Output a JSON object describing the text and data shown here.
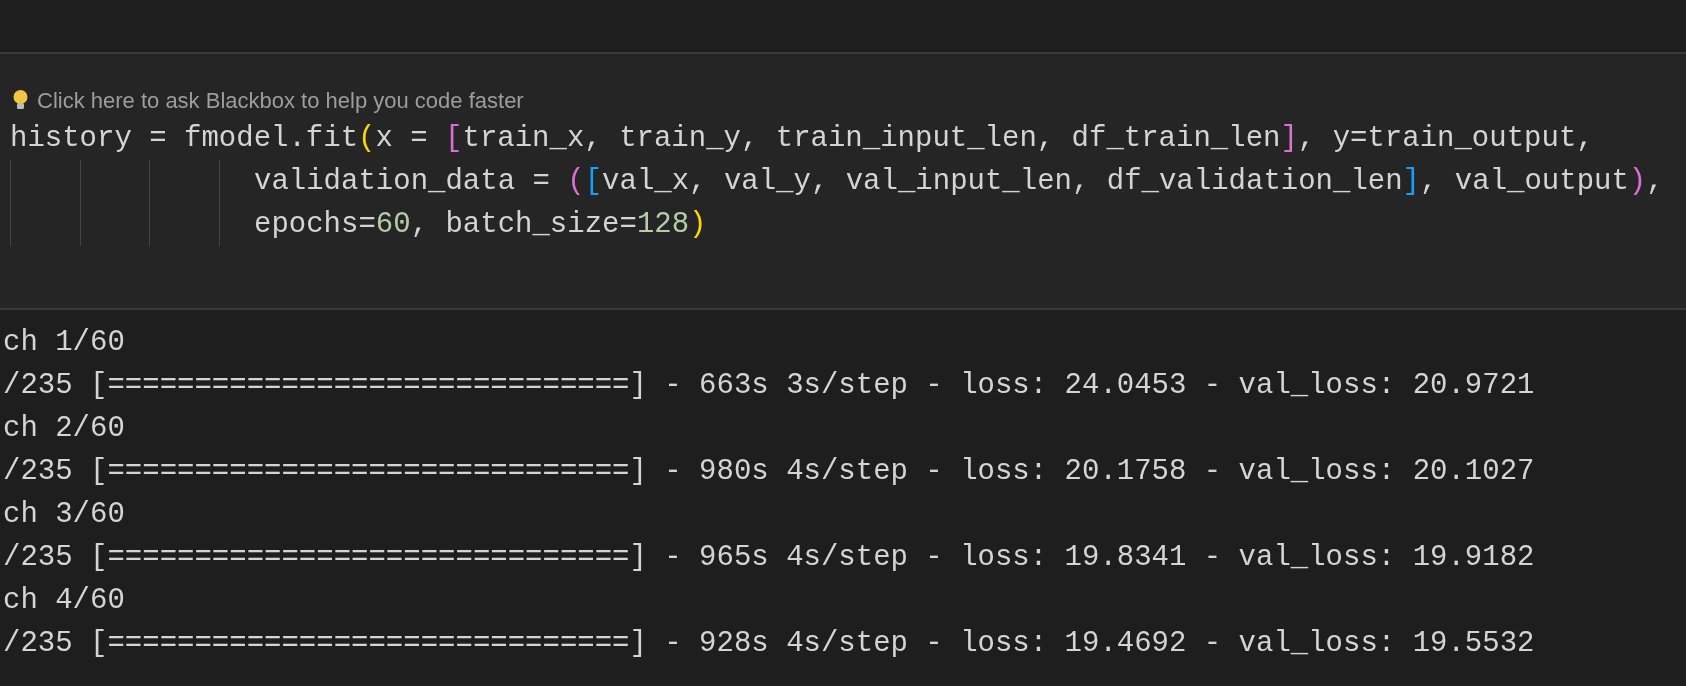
{
  "code_cell": {
    "hint": "Click here to ask Blackbox to help you code faster",
    "lines": [
      {
        "indent_guides": false,
        "tokens": [
          {
            "kind": "plain",
            "text": "history = fmodel.fit"
          },
          {
            "kind": "bracket",
            "text": "(",
            "color": "#ffd700"
          },
          {
            "kind": "plain",
            "text": "x = "
          },
          {
            "kind": "bracket",
            "text": "[",
            "color": "#da70d6"
          },
          {
            "kind": "plain",
            "text": "train_x, train_y, train_input_len, df_train_len"
          },
          {
            "kind": "bracket",
            "text": "]",
            "color": "#da70d6"
          },
          {
            "kind": "plain",
            "text": ", y=train_output,"
          }
        ]
      },
      {
        "indent_guides": true,
        "tokens": [
          {
            "kind": "plain",
            "text": "validation_data = "
          },
          {
            "kind": "bracket",
            "text": "(",
            "color": "#da70d6"
          },
          {
            "kind": "bracket",
            "text": "[",
            "color": "#179fff"
          },
          {
            "kind": "plain",
            "text": "val_x, val_y, val_input_len, df_validation_len"
          },
          {
            "kind": "bracket",
            "text": "]",
            "color": "#179fff"
          },
          {
            "kind": "plain",
            "text": ", val_output"
          },
          {
            "kind": "bracket",
            "text": ")",
            "color": "#da70d6"
          },
          {
            "kind": "plain",
            "text": ","
          }
        ]
      },
      {
        "indent_guides": true,
        "tokens": [
          {
            "kind": "plain",
            "text": "epochs="
          },
          {
            "kind": "number",
            "text": "60"
          },
          {
            "kind": "plain",
            "text": ", batch_size="
          },
          {
            "kind": "number",
            "text": "128"
          },
          {
            "kind": "bracket",
            "text": ")",
            "color": "#ffd700"
          }
        ]
      }
    ]
  },
  "output": {
    "lines": [
      "ch 1/60",
      "/235 [==============================] - 663s 3s/step - loss: 24.0453 - val_loss: 20.9721",
      "ch 2/60",
      "/235 [==============================] - 980s 4s/step - loss: 20.1758 - val_loss: 20.1027",
      "ch 3/60",
      "/235 [==============================] - 965s 4s/step - loss: 19.8341 - val_loss: 19.9182",
      "ch 4/60",
      "/235 [==============================] - 928s 4s/step - loss: 19.4692 - val_loss: 19.5532"
    ]
  }
}
